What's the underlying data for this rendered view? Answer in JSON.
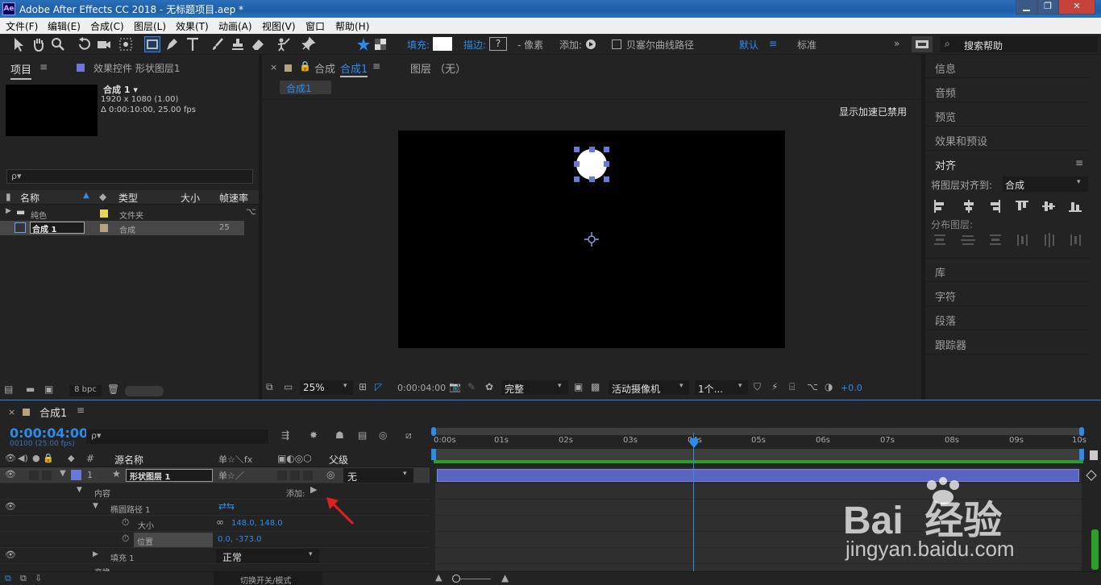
{
  "window": {
    "title": "Adobe After Effects CC 2018 - 无标题项目.aep *",
    "logo": "Ae",
    "controls": [
      "minimize-icon",
      "restore-icon",
      "close-icon"
    ]
  },
  "menu": [
    "文件(F)",
    "编辑(E)",
    "合成(C)",
    "图层(L)",
    "效果(T)",
    "动画(A)",
    "视图(V)",
    "窗口",
    "帮助(H)"
  ],
  "toolbar": {
    "fill_label": "填充:",
    "stroke_label": "描边:",
    "stroke_value": "?",
    "stroke_unit": "- 像素",
    "add_label": "添加:",
    "bezier_label": "贝塞尔曲线路径",
    "workspace_default": "默认",
    "workspace_standard": "标准",
    "search_placeholder": "搜索帮助"
  },
  "project_panel": {
    "tab_project": "项目",
    "tab_effects": "效果控件 形状图层1",
    "comp_name": "合成 1 ▾",
    "comp_size": "1920 x 1080 (1.00)",
    "comp_duration": "Δ 0:00:10:00, 25.00 fps",
    "search_placeholder": "ρ▾",
    "columns": [
      "名称",
      "类型",
      "大小",
      "帧速率"
    ],
    "rows": [
      {
        "name": "纯色",
        "type": "文件夹",
        "fps": ""
      },
      {
        "name": "合成 1",
        "type": "合成",
        "fps": "25"
      }
    ],
    "bpc": "8 bpc",
    "colors": {
      "folder": "#e7d55a",
      "comp": "#b4a381"
    }
  },
  "comp_panel": {
    "tab_label": "合成",
    "tab_name": "合成1",
    "layer_tab": "图层 （无）",
    "breadcrumb": "合成1",
    "accel_notice": "显示加速已禁用",
    "zoom": "25%",
    "timecode": "0:00:04:00",
    "quality": "完整",
    "camera": "活动摄像机",
    "views": "1个...",
    "exposure": "+0.0"
  },
  "right_panel": {
    "items_top": [
      "信息",
      "音频",
      "预览",
      "效果和预设"
    ],
    "align_title": "对齐",
    "align_to_label": "将图层对齐到:",
    "align_to_value": "合成",
    "distribute_label": "分布图层:",
    "items_bottom": [
      "库",
      "字符",
      "段落",
      "跟踪器"
    ]
  },
  "timeline": {
    "tab_name": "合成1",
    "timecode": "0:00:04:00",
    "timecode_sub": "00100 (25.00 fps)",
    "search_placeholder": "ρ▾",
    "col_hash": "#",
    "col_source": "源名称",
    "col_parent": "父级",
    "col_switch_icons": "单☆＼fx",
    "layer_num": "1",
    "layer_name": "形状图层 1",
    "parent_value": "无",
    "contents_label": "内容",
    "add_label": "添加:",
    "ellipse_path": "椭圆路径 1",
    "size_label": "大小",
    "size_value": "148.0, 148.0",
    "position_label": "位置",
    "position_value": "0.0, -373.0",
    "fill_label": "填充 1",
    "fill_mode": "正常",
    "transform_label": "变换",
    "toggle_label": "切换开关/模式",
    "ruler": [
      "0:00s",
      "01s",
      "02s",
      "03s",
      "04s",
      "05s",
      "06s",
      "07s",
      "08s",
      "09s",
      "10s"
    ],
    "label_color": "#6b78d6"
  },
  "watermark": {
    "brand": "Bai  经验",
    "url": "jingyan.baidu.com"
  }
}
